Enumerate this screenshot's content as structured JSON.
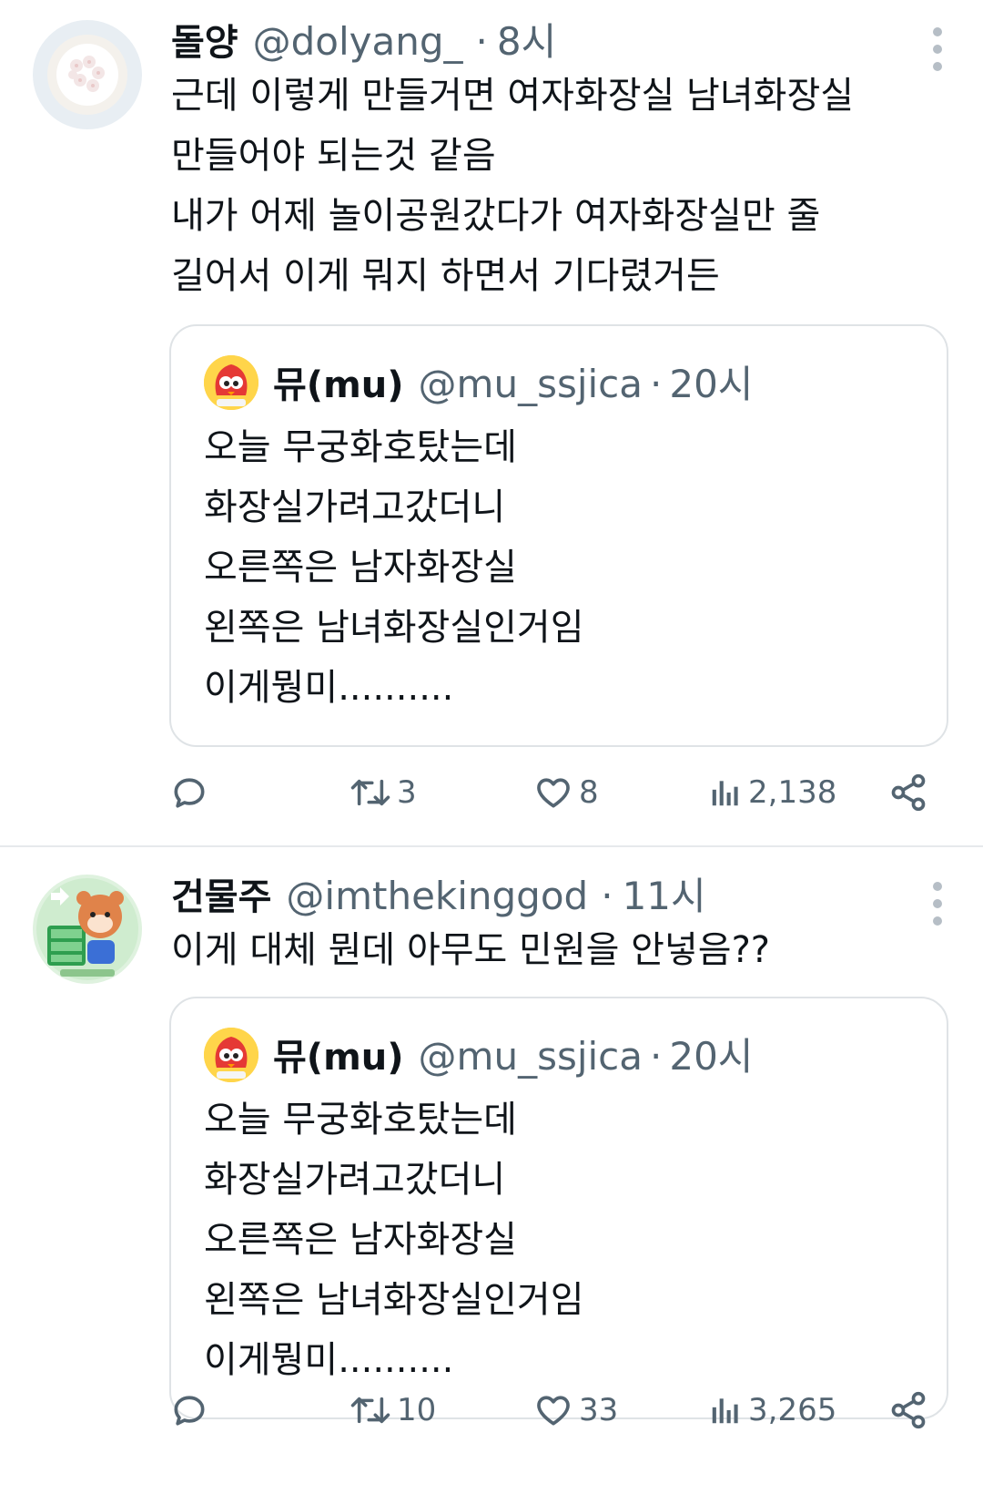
{
  "tweets": [
    {
      "author_name": "돌양",
      "handle": "@dolyang_",
      "time": "8시",
      "body_lines": [
        "근데 이렇게 만들거면 여자화장실 남녀화장실",
        "만들어야 되는것 같음",
        "내가 어제 놀이공원갔다가 여자화장실만 줄",
        "길어서 이게 뭐지 하면서 기다렸거든"
      ],
      "quote": {
        "author_name": "뮤(mu)",
        "handle": "@mu_ssjica",
        "time": "20시",
        "body_lines": [
          "오늘 무궁화호탔는데",
          "화장실가려고갔더니",
          "오른쪽은 남자화장실",
          "왼쪽은 남녀화장실인거임",
          "이게뭥미.........."
        ]
      },
      "actions": {
        "replies": "",
        "retweets": "3",
        "likes": "8",
        "views": "2,138"
      }
    },
    {
      "author_name": "건물주",
      "handle": "@imthekinggod",
      "time": "11시",
      "body_lines": [
        "이게 대체 뭔데 아무도 민원을 안넣음??"
      ],
      "quote": {
        "author_name": "뮤(mu)",
        "handle": "@mu_ssjica",
        "time": "20시",
        "body_lines": [
          "오늘 무궁화호탔는데",
          "화장실가려고갔더니",
          "오른쪽은 남자화장실",
          "왼쪽은 남녀화장실인거임",
          "이게뭥미.........."
        ]
      },
      "actions": {
        "replies": "",
        "retweets": "10",
        "likes": "33",
        "views": "3,265"
      }
    }
  ],
  "icons": {
    "reply": "reply-icon",
    "retweet": "retweet-icon",
    "like": "heart-icon",
    "views": "views-icon",
    "share": "share-icon",
    "more": "more-icon"
  },
  "colors": {
    "text": "#0f1419",
    "secondary": "#536471",
    "border": "#dfe3e6"
  }
}
